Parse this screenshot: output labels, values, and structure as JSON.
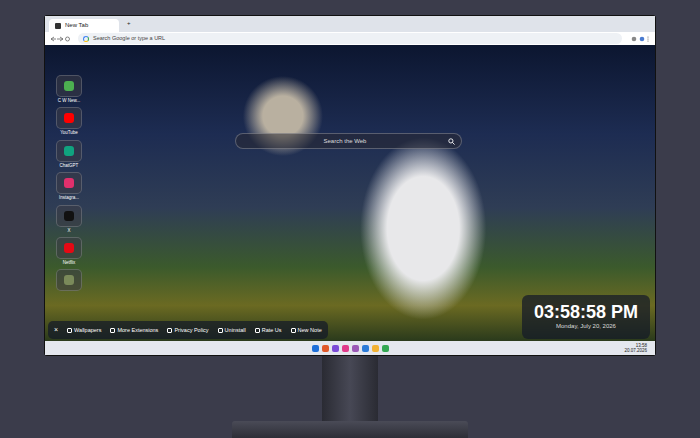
{
  "browser": {
    "tab_title": "New Tab",
    "new_tab": "+",
    "address_placeholder": "Search Google or type a URL"
  },
  "sidebar": {
    "items": [
      {
        "label": "C W New...",
        "color": "#4caf50"
      },
      {
        "label": "YouTube",
        "color": "#ff0000"
      },
      {
        "label": "ChatGPT",
        "color": "#10a37f"
      },
      {
        "label": "Instagra...",
        "color": "#e1306c"
      },
      {
        "label": "X",
        "color": "#111111"
      },
      {
        "label": "Netflix",
        "color": "#e50914"
      },
      {
        "label": "",
        "color": "#7a8a5a"
      }
    ]
  },
  "search": {
    "placeholder": "Search the Web"
  },
  "clock": {
    "time": "03:58:58 PM",
    "date": "Monday, July 20, 2026"
  },
  "toolbar": {
    "close": "×",
    "items": [
      {
        "label": "Wallpapers"
      },
      {
        "label": "More Extensions"
      },
      {
        "label": "Privacy Policy"
      },
      {
        "label": "Uninstall"
      },
      {
        "label": "Rate Us"
      },
      {
        "label": "New Note"
      }
    ]
  },
  "taskbar": {
    "time": "13:58",
    "date": "20.07.2026",
    "apps": [
      {
        "color": "#1e6fd9"
      },
      {
        "color": "#e0592a"
      },
      {
        "color": "#7b4bd6"
      },
      {
        "color": "#e03a8a"
      },
      {
        "color": "#9b59b6"
      },
      {
        "color": "#2b7bd8"
      },
      {
        "color": "#f2b233"
      },
      {
        "color": "#34a853"
      }
    ]
  }
}
